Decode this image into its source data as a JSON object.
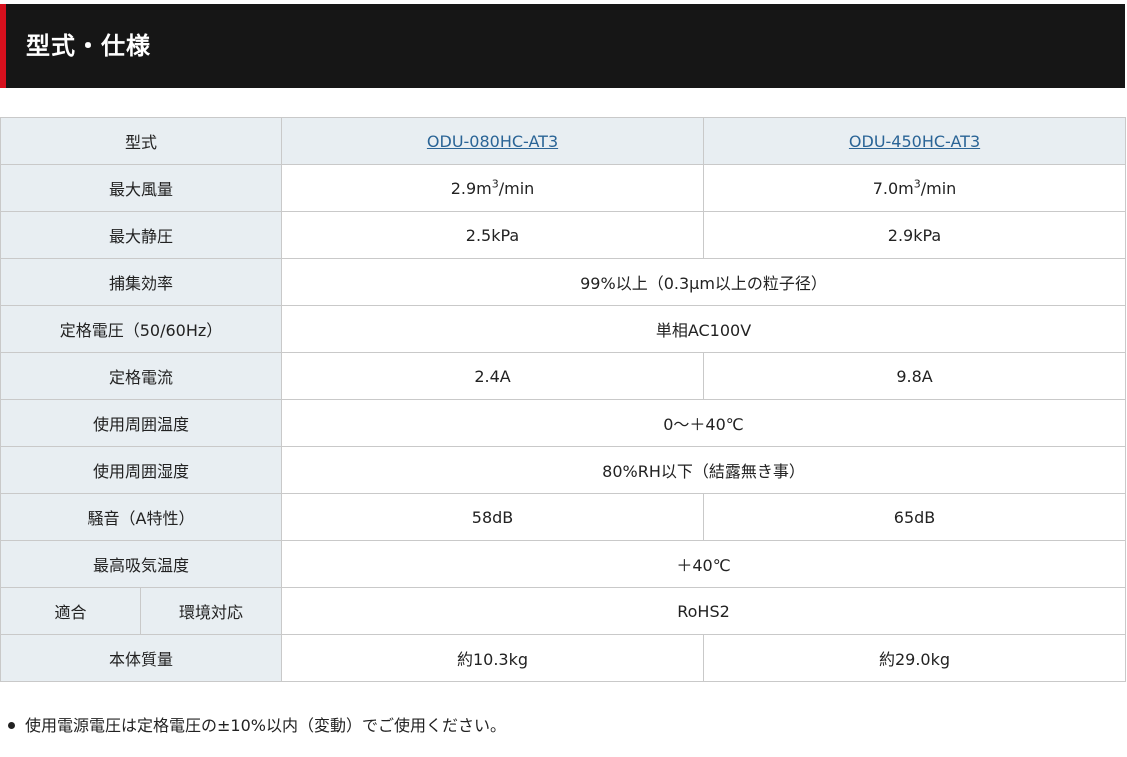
{
  "section": {
    "title": "型式・仕様"
  },
  "table": {
    "header": {
      "label": "型式",
      "models": [
        "ODU-080HC-AT3",
        "ODU-450HC-AT3"
      ]
    },
    "rows": [
      {
        "label": "最大風量",
        "v1": "2.9m",
        "v1_sup": "3",
        "v1_unit": "/min",
        "v2": "7.0m",
        "v2_sup": "3",
        "v2_unit": "/min"
      },
      {
        "label": "最大静圧",
        "v1": "2.5kPa",
        "v2": "2.9kPa"
      },
      {
        "label": "捕集効率",
        "span": "99%以上（0.3μm以上の粒子径）"
      },
      {
        "label": "定格電圧（50/60Hz）",
        "span": "単相AC100V"
      },
      {
        "label": "定格電流",
        "v1": "2.4A",
        "v2": "9.8A"
      },
      {
        "label": "使用周囲温度",
        "span": "0～＋40℃"
      },
      {
        "label": "使用周囲湿度",
        "span": "80%RH以下（結露無き事）"
      },
      {
        "label": "騒音（A特性）",
        "v1": "58dB",
        "v2": "65dB"
      },
      {
        "label": "最高吸気温度",
        "span": "＋40℃"
      },
      {
        "label_a": "適合",
        "label_b": "環境対応",
        "span": "RoHS2"
      },
      {
        "label": "本体質量",
        "v1": "約10.3kg",
        "v2": "約29.0kg"
      }
    ]
  },
  "note": "使用電源電圧は定格電圧の±10%以内（変動）でご使用ください。",
  "colors": {
    "header_bg": "#161616",
    "accent": "#d6101d",
    "label_bg": "#e8eef2",
    "link": "#2a6496"
  }
}
